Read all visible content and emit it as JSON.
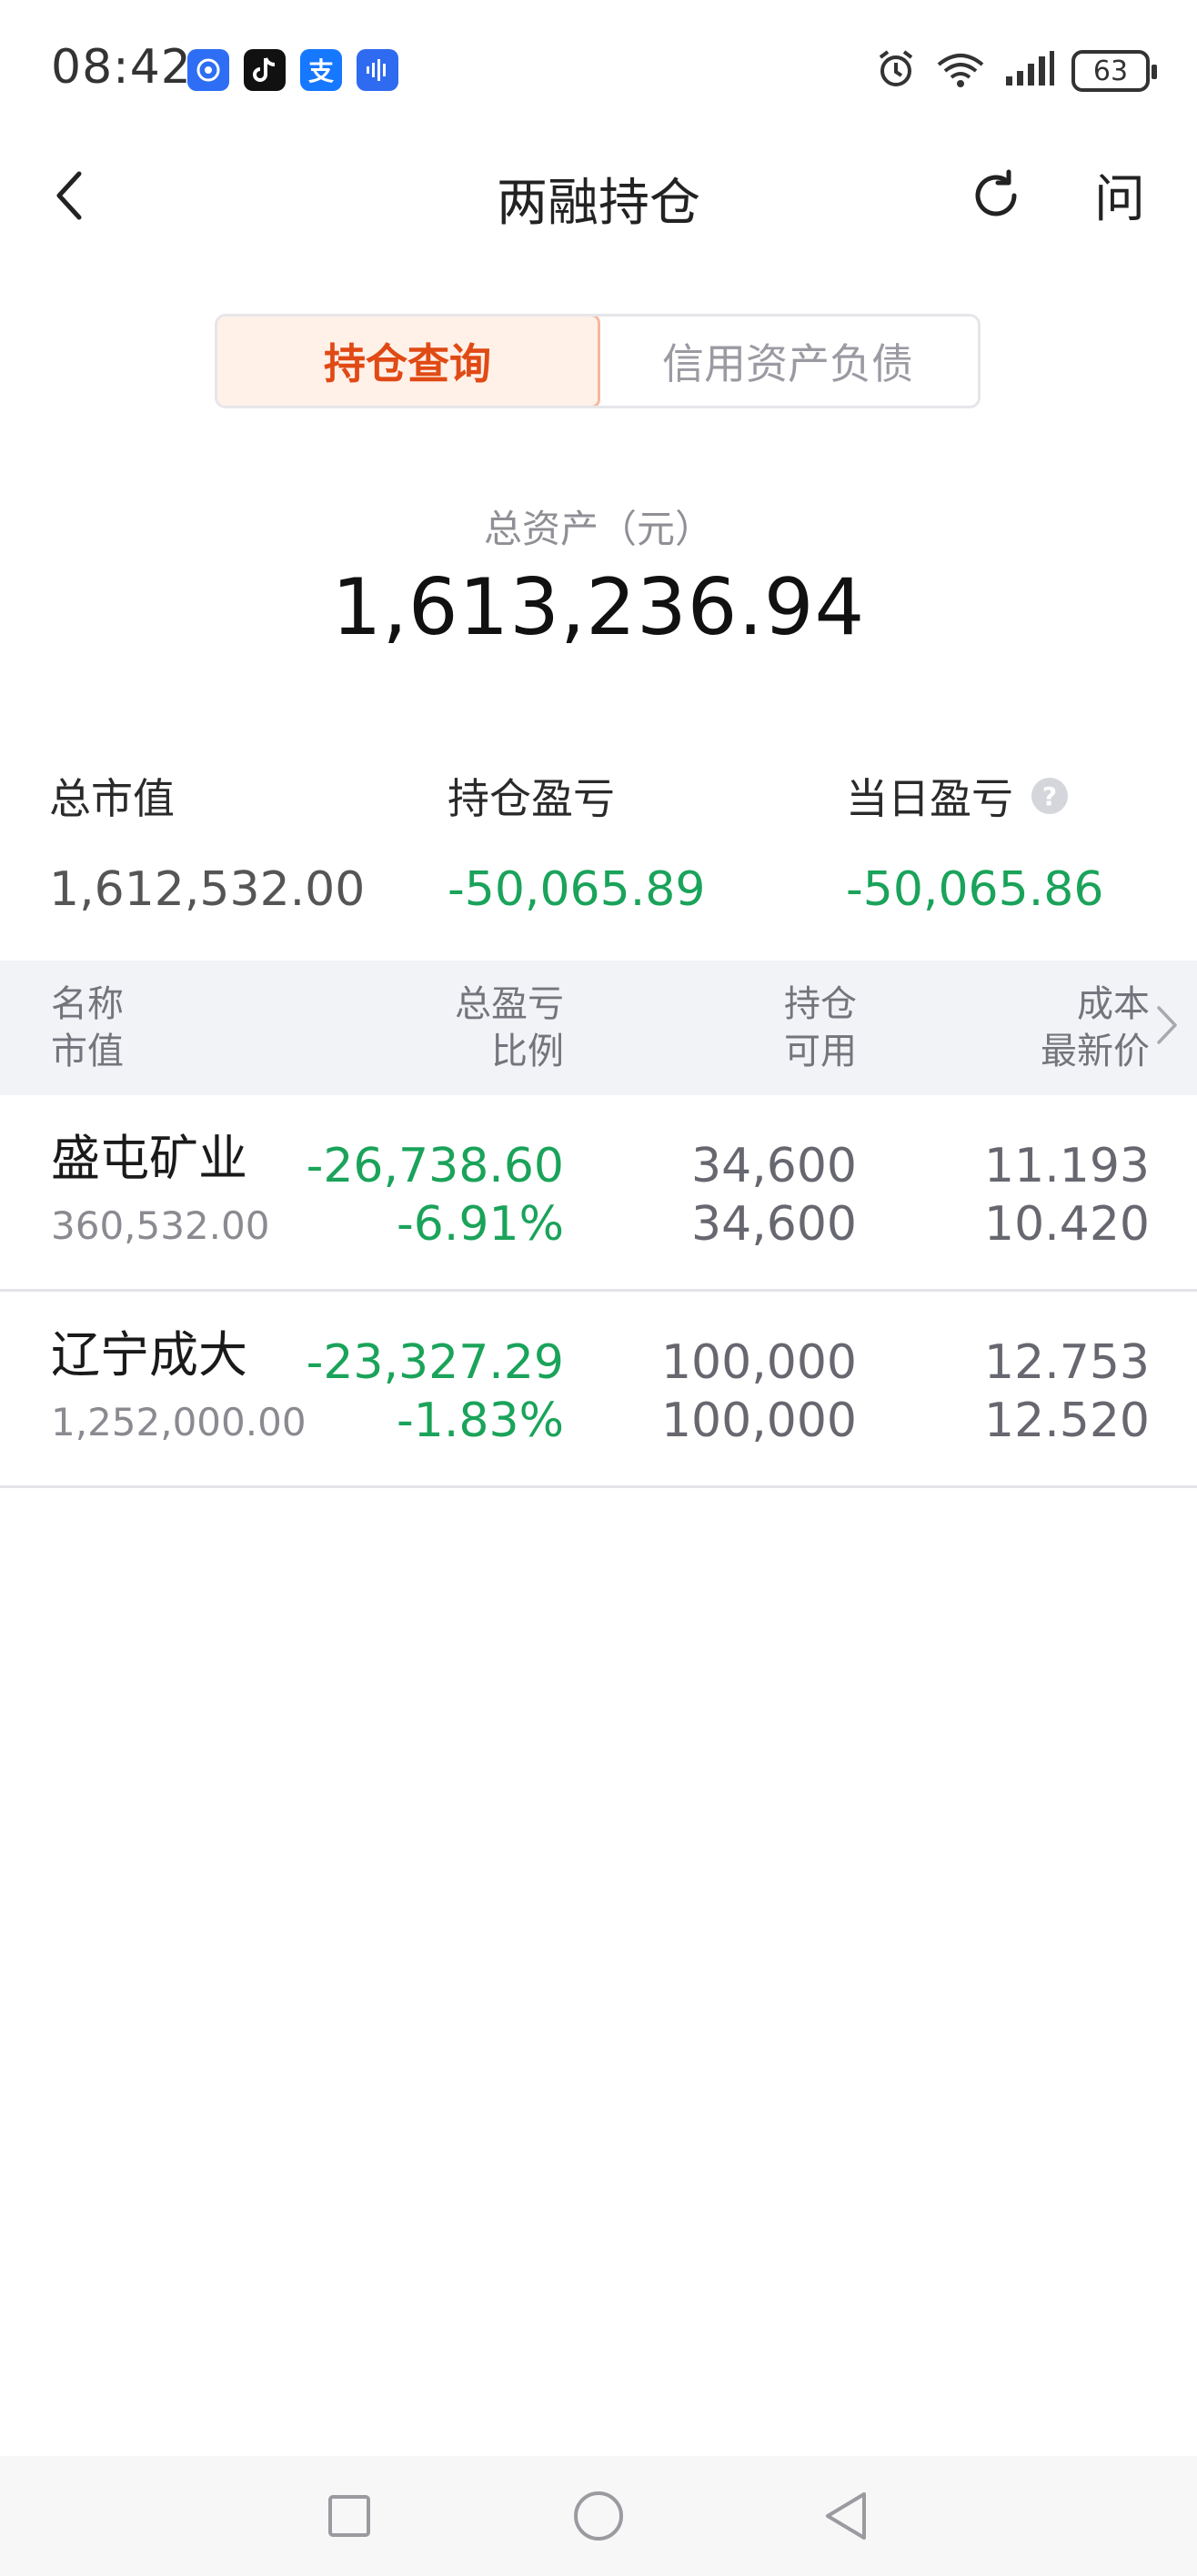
{
  "status_bar": {
    "time": "08:42",
    "app_icons": [
      "app-shield-icon",
      "tiktok-icon",
      "alipay-icon",
      "voice-app-icon"
    ],
    "alipay_glyph": "支",
    "right_icons": [
      "alarm-icon",
      "wifi-icon",
      "signal-icon"
    ],
    "battery": "63"
  },
  "header": {
    "title": "两融持仓",
    "help_label": "问"
  },
  "tabs": [
    {
      "label": "持仓查询",
      "active": true
    },
    {
      "label": "信用资产负债",
      "active": false
    }
  ],
  "summary": {
    "total_label": "总资产（元）",
    "total_value": "1,613,236.94",
    "stats": [
      {
        "label": "总市值",
        "value": "1,612,532.00"
      },
      {
        "label": "持仓盈亏",
        "value": "-50,065.89"
      },
      {
        "label": "当日盈亏",
        "value": "-50,065.86",
        "help": "?"
      }
    ]
  },
  "table": {
    "headers": [
      {
        "top": "名称",
        "bottom": "市值"
      },
      {
        "top": "总盈亏",
        "bottom": "比例"
      },
      {
        "top": "持仓",
        "bottom": "可用"
      },
      {
        "top": "成本",
        "bottom": "最新价"
      }
    ],
    "rows": [
      {
        "name": "盛屯矿业",
        "market_value": "360,532.00",
        "total_pl": "-26,738.60",
        "ratio": "-6.91%",
        "position": "34,600",
        "available": "34,600",
        "cost": "11.193",
        "latest_price": "10.420"
      },
      {
        "name": "辽宁成大",
        "market_value": "1,252,000.00",
        "total_pl": "-23,327.29",
        "ratio": "-1.83%",
        "position": "100,000",
        "available": "100,000",
        "cost": "12.753",
        "latest_price": "12.520"
      }
    ]
  },
  "colors": {
    "loss_green": "#1aa35a",
    "accent_orange": "#e04a14",
    "tab_active_bg": "#fff0e8"
  },
  "navbar": {
    "buttons": [
      "recent-apps-icon",
      "home-icon",
      "back-triangle-icon"
    ]
  }
}
